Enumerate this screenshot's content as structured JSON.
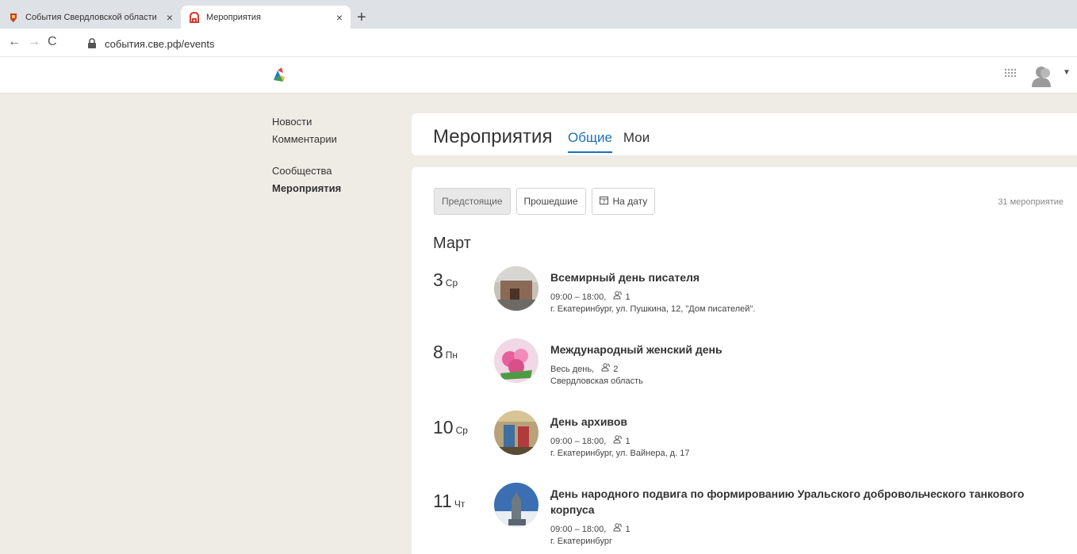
{
  "browser": {
    "tabs": [
      {
        "title": "События Свердловской области",
        "active": false,
        "close": "×"
      },
      {
        "title": "Мероприятия",
        "active": true,
        "close": "×"
      }
    ],
    "new_tab": "+",
    "url": "события.све.рф/events"
  },
  "nav": {
    "items": [
      "Новости",
      "Комментарии",
      "Сообщества",
      "Мероприятия"
    ],
    "active": "Мероприятия"
  },
  "page": {
    "title": "Мероприятия",
    "tabs": [
      "Общие",
      "Мои"
    ]
  },
  "filters": {
    "upcoming": "Предстоящие",
    "past": "Прошедшие",
    "by_date": "На дату",
    "count": "31 мероприятие"
  },
  "month": "Март",
  "events": [
    {
      "day": "3",
      "weekday": "Ср",
      "name": "Всемирный день писателя",
      "time": "09:00 – 18:00,",
      "participants": "1",
      "place": "г. Екатеринбург, ул. Пушкина, 12, \"Дом писателей\"."
    },
    {
      "day": "8",
      "weekday": "Пн",
      "name": "Международный женский день",
      "time": "Весь день,",
      "participants": "2",
      "place": "Свердловская область"
    },
    {
      "day": "10",
      "weekday": "Ср",
      "name": "День архивов",
      "time": "09:00 – 18:00,",
      "participants": "1",
      "place": "г. Екатеринбург, ул. Вайнера, д. 17"
    },
    {
      "day": "11",
      "weekday": "Чт",
      "name": "День народного подвига по формированию Уральского добровольческого танкового корпуса",
      "time": "09:00 – 18:00,",
      "participants": "1",
      "place": "г. Екатеринбург"
    }
  ],
  "colors": {
    "accent": "#1b70b8",
    "page_bg": "#efece6"
  }
}
